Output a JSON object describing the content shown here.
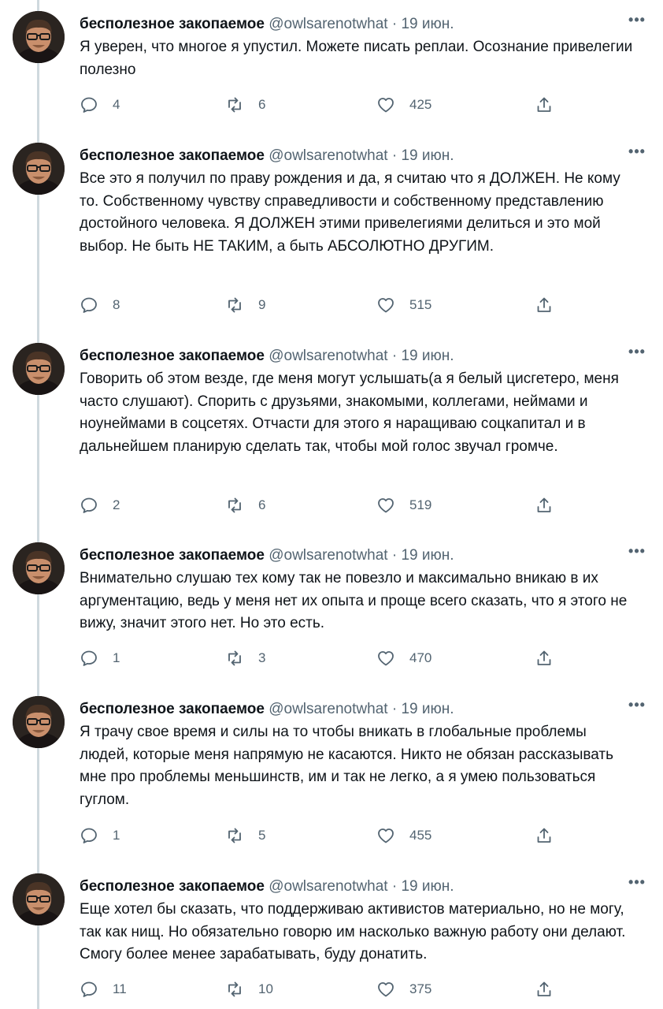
{
  "tweets": [
    {
      "name": "бесполезное закопаемое",
      "handle": "@owlsarenotwhat",
      "separator": "·",
      "date": "19 июн.",
      "more": "•••",
      "text": "Я уверен, что многое я упустил. Можете писать реплаи. Осознание привелегии полезно",
      "replies": "4",
      "retweets": "6",
      "likes": "425"
    },
    {
      "name": "бесполезное закопаемое",
      "handle": "@owlsarenotwhat",
      "separator": "·",
      "date": "19 июн.",
      "more": "•••",
      "text": "Все это я получил по праву рождения и да, я считаю что я ДОЛЖЕН. Не кому то. Собственному чувству справедливости и собственному представлению достойного человека. Я ДОЛЖЕН этими привелегиями делиться и это мой выбор. Не быть НЕ ТАКИМ, а быть АБСОЛЮТНО ДРУГИМ.",
      "replies": "8",
      "retweets": "9",
      "likes": "515"
    },
    {
      "name": "бесполезное закопаемое",
      "handle": "@owlsarenotwhat",
      "separator": "·",
      "date": "19 июн.",
      "more": "•••",
      "text": "Говорить об этом везде, где меня могут услышать(а я белый цисгетеро, меня часто слушают). Спорить с друзьями, знакомыми, коллегами, неймами и ноунеймами в соцсетях. Отчасти для этого я наращиваю соцкапитал и в дальнейшем планирую сделать так, чтобы мой голос звучал громче.",
      "replies": "2",
      "retweets": "6",
      "likes": "519"
    },
    {
      "name": "бесполезное закопаемое",
      "handle": "@owlsarenotwhat",
      "separator": "·",
      "date": "19 июн.",
      "more": "•••",
      "text": "Внимательно слушаю тех кому так не повезло и максимально вникаю в их аргументацию, ведь у меня нет их опыта и проще всего сказать, что я этого не вижу, значит этого нет. Но это есть.",
      "replies": "1",
      "retweets": "3",
      "likes": "470"
    },
    {
      "name": "бесполезное закопаемое",
      "handle": "@owlsarenotwhat",
      "separator": "·",
      "date": "19 июн.",
      "more": "•••",
      "text": "Я трачу свое время и силы на то чтобы вникать в глобальные проблемы людей, которые меня напрямую не касаются. Никто не обязан рассказывать мне про проблемы меньшинств, им и так не легко, а я умею пользоваться гуглом.",
      "replies": "1",
      "retweets": "5",
      "likes": "455"
    },
    {
      "name": "бесполезное закопаемое",
      "handle": "@owlsarenotwhat",
      "separator": "·",
      "date": "19 июн.",
      "more": "•••",
      "text": "Еще хотел бы сказать, что поддерживаю активистов материально, но не могу, так как нищ. Но обязательно говорю им насколько важную работу они делают. Смогу более менее зарабатывать, буду донатить.",
      "replies": "11",
      "retweets": "10",
      "likes": "375"
    }
  ],
  "icons": {
    "reply": "reply-icon",
    "retweet": "retweet-icon",
    "like": "heart-icon",
    "share": "share-icon",
    "more": "more-icon"
  },
  "colors": {
    "text": "#0f1419",
    "secondary": "#536471",
    "thread_line": "#cfd9de"
  }
}
